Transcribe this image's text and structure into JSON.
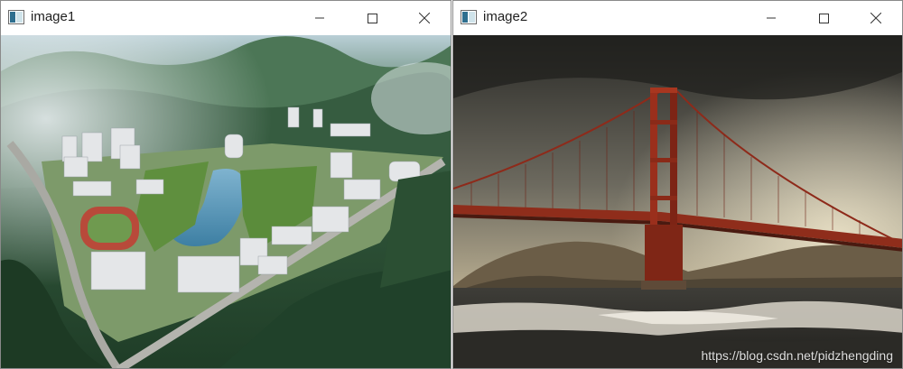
{
  "windows": [
    {
      "title": "image1"
    },
    {
      "title": "image2",
      "watermark": "https://blog.csdn.net/pidzhengding"
    }
  ],
  "icons": {
    "app": "image-viewer-icon",
    "minimize": "minimize-icon",
    "maximize": "maximize-icon",
    "close": "close-icon"
  }
}
